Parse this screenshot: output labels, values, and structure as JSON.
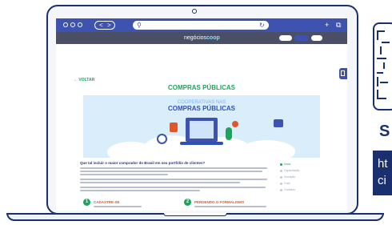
{
  "browser": {
    "nav_back": "<",
    "nav_forward": ">",
    "url_icon": "search-icon",
    "reload_icon": "reload-icon",
    "new_tab": "+",
    "copy_icon": "copy-icon"
  },
  "site": {
    "logo_text": "negócios",
    "logo_accent": "coop"
  },
  "page": {
    "back_label": "← VOLTAR",
    "title": "COMPRAS PÚBLICAS",
    "hero_supertitle": "COOPERATIVAS NAS",
    "hero_title": "COMPRAS PÚBLICAS",
    "section_title": "Que tal incluir o maior comprador do Brasil em seu portfólio de clientes?",
    "toc": [
      "Início",
      "Capacitação",
      "Inovação",
      "Guia",
      "Contatos"
    ],
    "steps": [
      {
        "number": "1",
        "label": "CADASTRE-SE"
      },
      {
        "number": "2",
        "label": "PERDENDO O FORMALISMO"
      }
    ]
  },
  "side_card": {
    "letter": "S",
    "link_line1": "ht",
    "link_line2": "ci"
  },
  "colors": {
    "brand_blue": "#3e53b0",
    "navy": "#1a2f6e",
    "green": "#1fa35c",
    "header_gray": "#4a4f66",
    "accent_orange": "#e0562b"
  }
}
